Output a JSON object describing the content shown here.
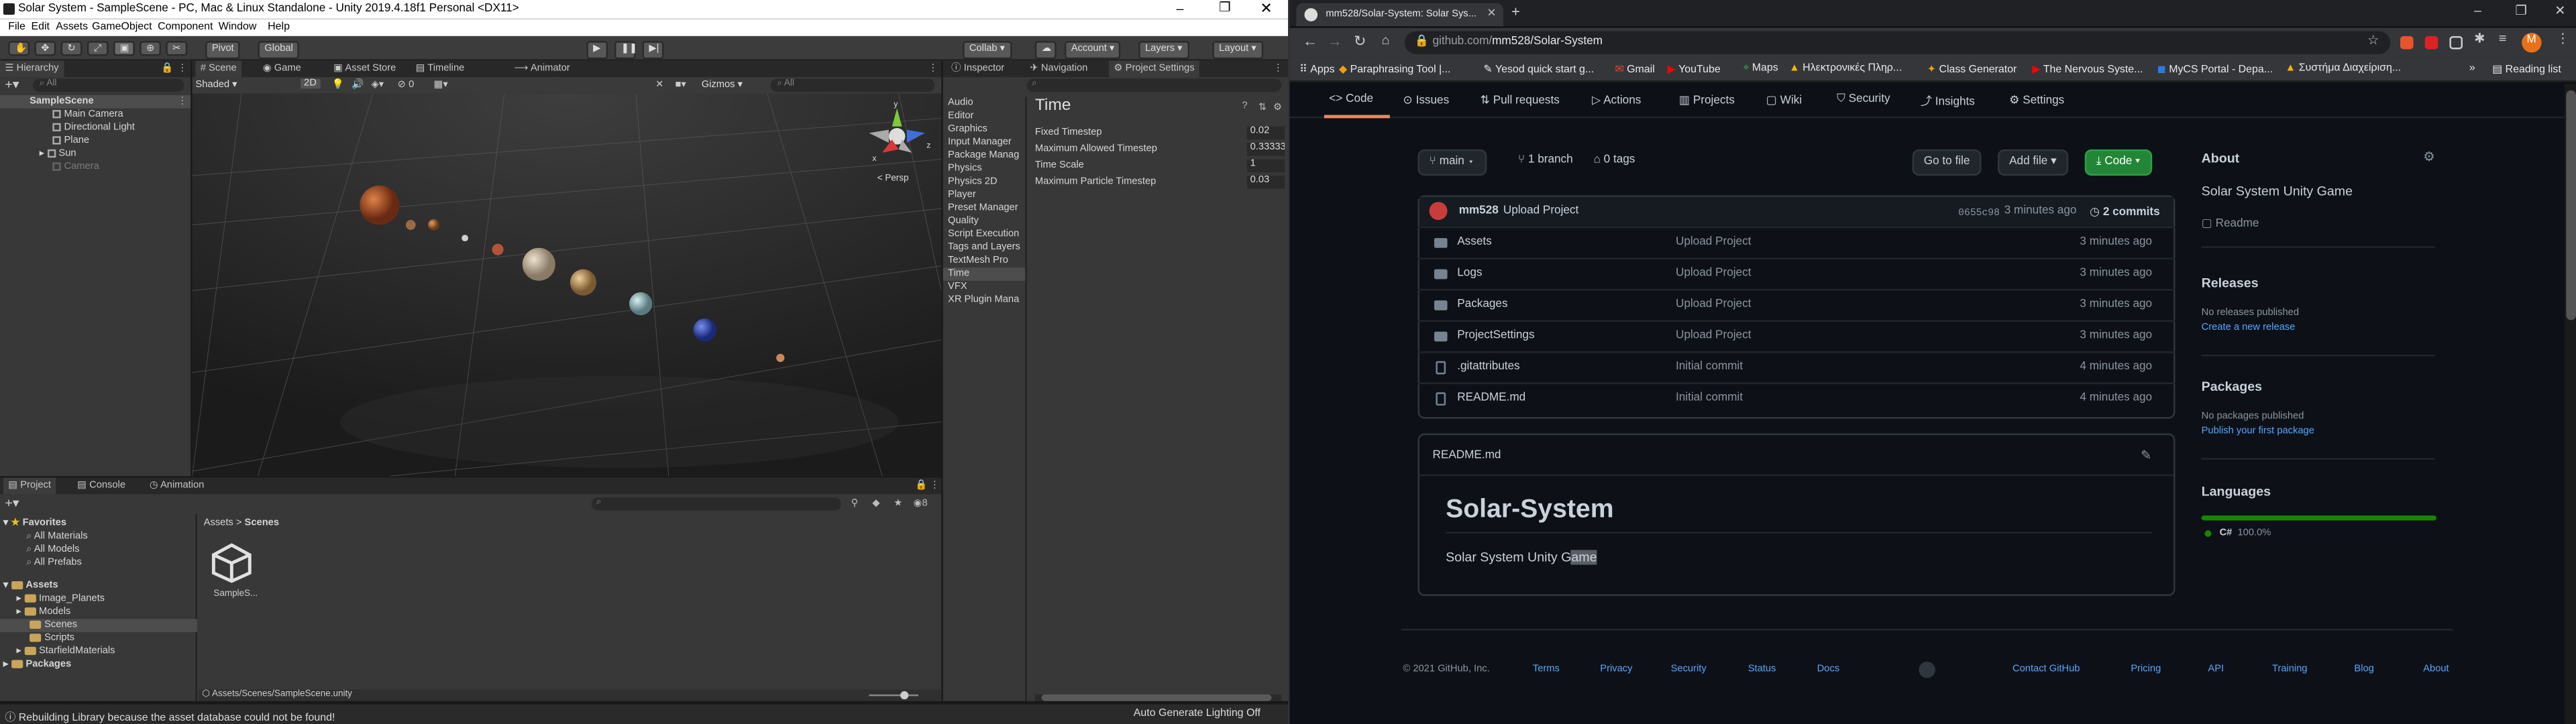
{
  "unity": {
    "window_title": "Solar System - SampleScene - PC, Mac & Linux Standalone - Unity 2019.4.18f1 Personal <DX11>",
    "menu": [
      "File",
      "Edit",
      "Assets",
      "GameObject",
      "Component",
      "Window",
      "Help"
    ],
    "toolbar": {
      "pivot": "Pivot",
      "global": "Global",
      "collab": "Collab",
      "account": "Account",
      "layers": "Layers",
      "layout": "Layout"
    },
    "hierarchy": {
      "tab": "Hierarchy",
      "search": "All",
      "scene": "SampleScene",
      "items": [
        "Main Camera",
        "Directional Light",
        "Plane",
        "Sun",
        "Camera"
      ]
    },
    "scene_tabs": [
      "Scene",
      "Game",
      "Asset Store",
      "Timeline",
      "Animator"
    ],
    "scene_bar": {
      "shading": "Shaded",
      "mode": "2D",
      "gizmos": "Gizmos",
      "search": "All",
      "count": "0"
    },
    "gizmo_label": "< Persp",
    "inspector_tabs": [
      "Inspector",
      "Navigation",
      "Project Settings"
    ],
    "settings_categories": [
      "Audio",
      "Editor",
      "Graphics",
      "Input Manager",
      "Package Manag",
      "Physics",
      "Physics 2D",
      "Player",
      "Preset Manager",
      "Quality",
      "Script Execution",
      "Tags and Layers",
      "TextMesh Pro",
      "Time",
      "VFX",
      "XR Plugin Mana"
    ],
    "selected_category": "Time",
    "time_settings": {
      "title": "Time",
      "rows": [
        {
          "label": "Fixed Timestep",
          "value": "0.02"
        },
        {
          "label": "Maximum Allowed Timestep",
          "value": "0.33333"
        },
        {
          "label": "Time Scale",
          "value": "1"
        },
        {
          "label": "Maximum Particle Timestep",
          "value": "0.03"
        }
      ]
    },
    "project_tabs": [
      "Project",
      "Console",
      "Animation"
    ],
    "project_tree": {
      "favorites": "Favorites",
      "fav_items": [
        "All Materials",
        "All Models",
        "All Prefabs"
      ],
      "assets": "Assets",
      "asset_items": [
        "Image_Planets",
        "Models",
        "Scenes",
        "Scripts",
        "StarfieldMaterials"
      ],
      "packages": "Packages"
    },
    "breadcrumb": [
      "Assets",
      "Scenes"
    ],
    "asset_item": "SampleS...",
    "asset_path": "Assets/Scenes/SampleScene.unity",
    "badge_count": "8",
    "status_left": "Rebuilding Library because the asset database could not be found!",
    "status_right": "Auto Generate Lighting Off"
  },
  "browser": {
    "tab_title": "mm528/Solar-System: Solar Sys...",
    "url_gray": "github.com/",
    "url_path": "mm528/Solar-System",
    "bookmarks": [
      "Apps",
      "Paraphrasing Tool |...",
      "Yesod quick start g...",
      "Gmail",
      "YouTube",
      "Maps",
      "Ηλεκτρονικές Πληρ...",
      "Class Generator",
      "The Nervous Syste...",
      "MyCS Portal - Depa...",
      "Συστήμα Διαχείριση..."
    ],
    "reading_list": "Reading list",
    "avatar_letter": "M",
    "repo_tabs": [
      "Code",
      "Issues",
      "Pull requests",
      "Actions",
      "Projects",
      "Wiki",
      "Security",
      "Insights",
      "Settings"
    ],
    "branch": "main",
    "branches": "1 branch",
    "tags": "0 tags",
    "go_to_file": "Go to file",
    "add_file": "Add file",
    "code_btn": "Code",
    "commit": {
      "author": "mm528",
      "message": "Upload Project",
      "hash": "0655c98",
      "time": "3 minutes ago",
      "count": "2 commits"
    },
    "files": [
      {
        "name": "Assets",
        "msg": "Upload Project",
        "time": "3 minutes ago",
        "type": "folder"
      },
      {
        "name": "Logs",
        "msg": "Upload Project",
        "time": "3 minutes ago",
        "type": "folder"
      },
      {
        "name": "Packages",
        "msg": "Upload Project",
        "time": "3 minutes ago",
        "type": "folder"
      },
      {
        "name": "ProjectSettings",
        "msg": "Upload Project",
        "time": "3 minutes ago",
        "type": "folder"
      },
      {
        "name": ".gitattributes",
        "msg": "Initial commit",
        "time": "4 minutes ago",
        "type": "file"
      },
      {
        "name": "README.md",
        "msg": "Initial commit",
        "time": "4 minutes ago",
        "type": "file"
      }
    ],
    "readme_label": "README.md",
    "readme_title": "Solar-System",
    "readme_body_a": "Solar System Unity G",
    "readme_body_b": "ame",
    "about": {
      "title": "About",
      "desc": "Solar System Unity Game",
      "readme": "Readme"
    },
    "releases": {
      "title": "Releases",
      "none": "No releases published",
      "link": "Create a new release"
    },
    "packages": {
      "title": "Packages",
      "none": "No packages published",
      "link": "Publish your first package"
    },
    "languages": {
      "title": "Languages",
      "name": "C#",
      "pct": "100.0%",
      "color": "#178600"
    },
    "footer": [
      "© 2021 GitHub, Inc.",
      "Terms",
      "Privacy",
      "Security",
      "Status",
      "Docs",
      "Contact GitHub",
      "Pricing",
      "API",
      "Training",
      "Blog",
      "About"
    ]
  }
}
